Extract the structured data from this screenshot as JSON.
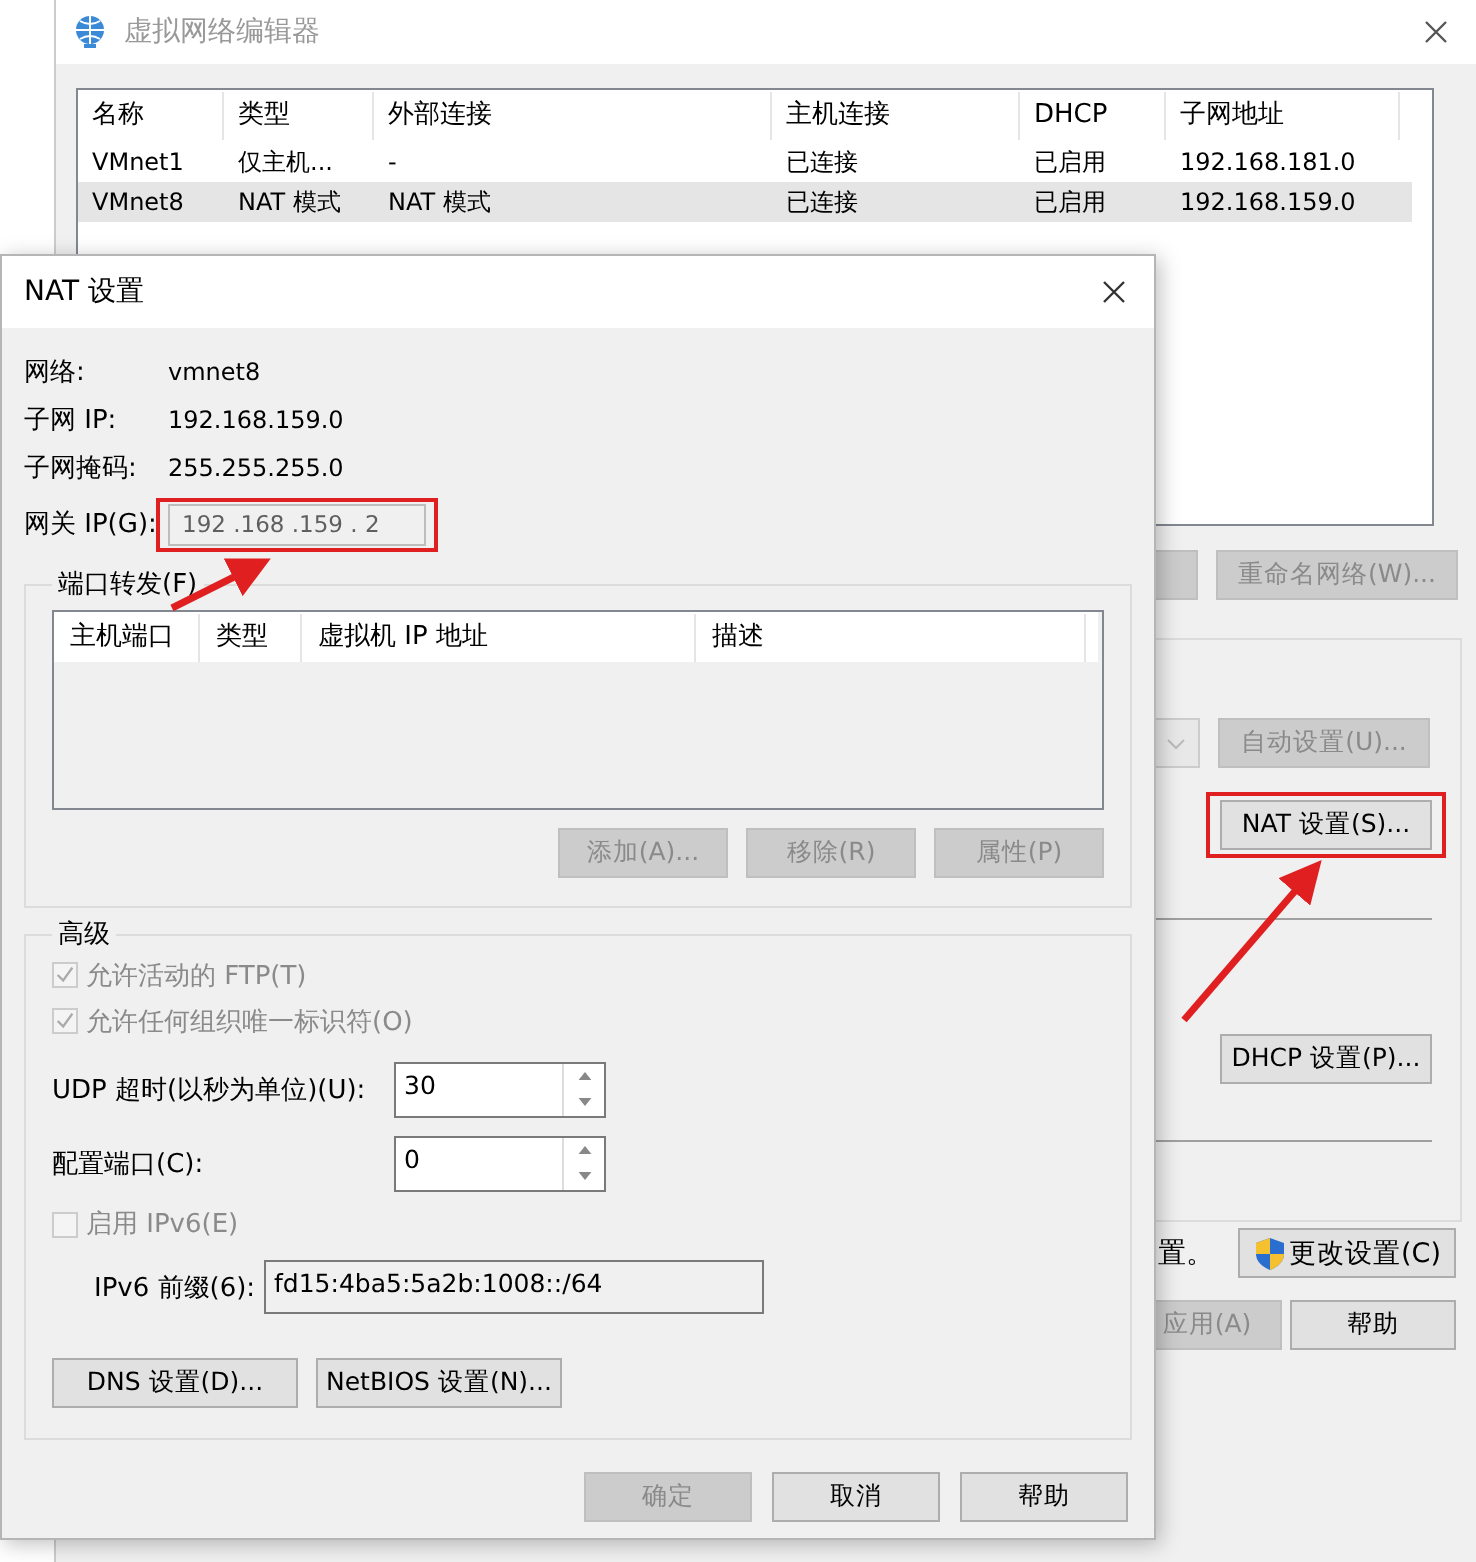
{
  "main_window": {
    "title": "虚拟网络编辑器",
    "columns": [
      "名称",
      "类型",
      "外部连接",
      "主机连接",
      "DHCP",
      "子网地址"
    ],
    "rows": [
      {
        "cells": [
          "VMnet1",
          "仅主机...",
          "-",
          "已连接",
          "已启用",
          "192.168.181.0"
        ],
        "selected": false
      },
      {
        "cells": [
          "VMnet8",
          "NAT 模式",
          "NAT 模式",
          "已连接",
          "已启用",
          "192.168.159.0"
        ],
        "selected": true
      }
    ],
    "rename_button": {
      "label": "重命名网络(W)...",
      "disabled": true
    },
    "auto_button": {
      "label": "自动设置(U)...",
      "disabled": true
    },
    "nat_button": {
      "label": "NAT 设置(S)...",
      "disabled": false,
      "highlighted": true
    },
    "dhcp_button": {
      "label": "DHCP 设置(P)...",
      "disabled": false
    },
    "notice_text": "置。",
    "change_settings_button": {
      "label": "更改设置(C)",
      "disabled": false
    },
    "apply_button": {
      "label": "应用(A)",
      "disabled": true
    },
    "help_button": {
      "label": "帮助",
      "disabled": false
    }
  },
  "nat_dialog": {
    "title": "NAT 设置",
    "info": [
      {
        "label": "网络:",
        "value": "vmnet8"
      },
      {
        "label": "子网 IP:",
        "value": "192.168.159.0"
      },
      {
        "label": "子网掩码:",
        "value": "255.255.255.0"
      }
    ],
    "gateway": {
      "label": "网关 IP(G):",
      "value": "192 .168 .159 . 2",
      "disabled": true,
      "highlighted": true
    },
    "port_forwarding": {
      "title": "端口转发(F)",
      "columns": [
        "主机端口",
        "类型",
        "虚拟机 IP 地址",
        "描述"
      ],
      "buttons": [
        {
          "label": "添加(A)...",
          "disabled": true
        },
        {
          "label": "移除(R)",
          "disabled": true
        },
        {
          "label": "属性(P)",
          "disabled": true
        }
      ]
    },
    "advanced": {
      "title": "高级",
      "options": [
        {
          "label": "允许活动的 FTP(T)",
          "checked": true,
          "disabled": true
        },
        {
          "label": "允许任何组织唯一标识符(O)",
          "checked": true,
          "disabled": true
        }
      ],
      "udp_timeout": {
        "label": "UDP 超时(以秒为单位)(U):",
        "value": "30"
      },
      "config_port": {
        "label": "配置端口(C):",
        "value": "0"
      },
      "ipv6": {
        "label": "启用 IPv6(E)",
        "checked": false,
        "disabled": true
      },
      "ipv6_prefix": {
        "label": "IPv6 前缀(6):",
        "value": "fd15:4ba5:5a2b:1008::/64"
      },
      "buttons": [
        {
          "label": "DNS 设置(D)...",
          "disabled": false
        },
        {
          "label": "NetBIOS 设置(N)...",
          "disabled": false
        }
      ]
    },
    "footer_buttons": [
      {
        "label": "确定",
        "disabled": true
      },
      {
        "label": "取消",
        "disabled": false
      },
      {
        "label": "帮助",
        "disabled": false
      }
    ]
  }
}
